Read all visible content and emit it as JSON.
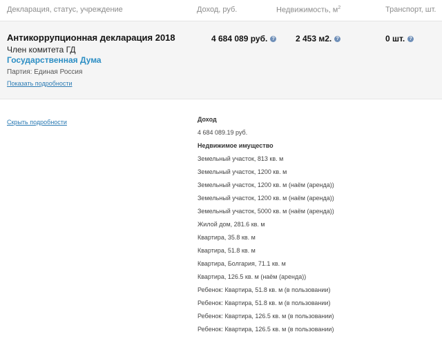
{
  "header": {
    "col_declaration": "Декларация, статус, учреждение",
    "col_income": "Доход, руб.",
    "col_realty": "Недвижимость, м",
    "col_realty_sup": "2",
    "col_transport": "Транспорт, шт."
  },
  "row": {
    "title": "Антикоррупционная декларация 2018",
    "position": "Член комитета ГД",
    "organization": "Государственная Дума",
    "party": "Партия: Единая Россия",
    "show_details": "Показать подробности",
    "income": "4 684 089 руб.",
    "realty": "2 453 м2.",
    "transport": "0 шт.",
    "info_glyph": "?"
  },
  "details": {
    "hide_link": "Скрыть подробности",
    "income_heading": "Доход",
    "income_value": "4 684 089.19 руб.",
    "realty_heading": "Недвижимое имущество",
    "realty_items": [
      "Земельный участок, 813 кв. м",
      "Земельный участок, 1200 кв. м",
      "Земельный участок, 1200 кв. м (наём (аренда))",
      "Земельный участок, 1200 кв. м (наём (аренда))",
      "Земельный участок, 5000 кв. м (наём (аренда))",
      "Жилой дом, 281.6 кв. м",
      "Квартира, 35.8 кв. м",
      "Квартира, 51.8 кв. м",
      "Квартира, Болгария, 71.1 кв. м",
      "Квартира, 126.5 кв. м (наём (аренда))",
      "Ребенок: Квартира, 51.8 кв. м (в пользовании)",
      "Ребенок: Квартира, 51.8 кв. м (в пользовании)",
      "Ребенок: Квартира, 126.5 кв. м (в пользовании)",
      "Ребенок: Квартира, 126.5 кв. м (в пользовании)"
    ]
  }
}
